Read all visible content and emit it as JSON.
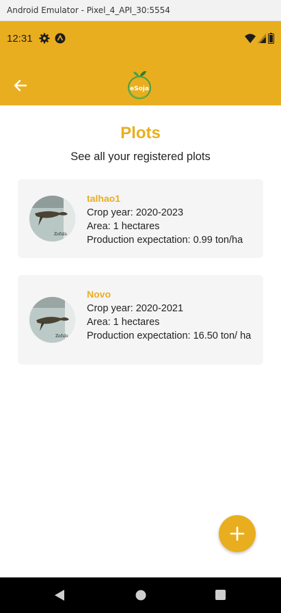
{
  "emulator": {
    "title": "Android Emulator - Pixel_4_API_30:5554"
  },
  "status_bar": {
    "time": "12:31",
    "icons": [
      "gear-icon",
      "a-badge-icon",
      "wifi-icon",
      "signal-icon",
      "battery-icon"
    ]
  },
  "app_bar": {
    "logo_text": "eSoja",
    "back_icon": "arrow-back-icon"
  },
  "page": {
    "title": "Plots",
    "subtitle": "See all your registered plots"
  },
  "plots": [
    {
      "name": "talhao1",
      "crop_year": "Crop year: 2020-2023",
      "area": "Area: 1 hectares",
      "production": "Production expectation: 0.99 ton/ha"
    },
    {
      "name": "Novo",
      "crop_year": "Crop year: 2020-2021",
      "area": "Area: 1 hectares",
      "production": "Production expectation: 16.50 ton/ ha"
    }
  ],
  "fab": {
    "icon": "plus-icon"
  },
  "colors": {
    "accent": "#E9AE1F",
    "card_bg": "#f5f5f5",
    "nav_bg": "#000000"
  }
}
